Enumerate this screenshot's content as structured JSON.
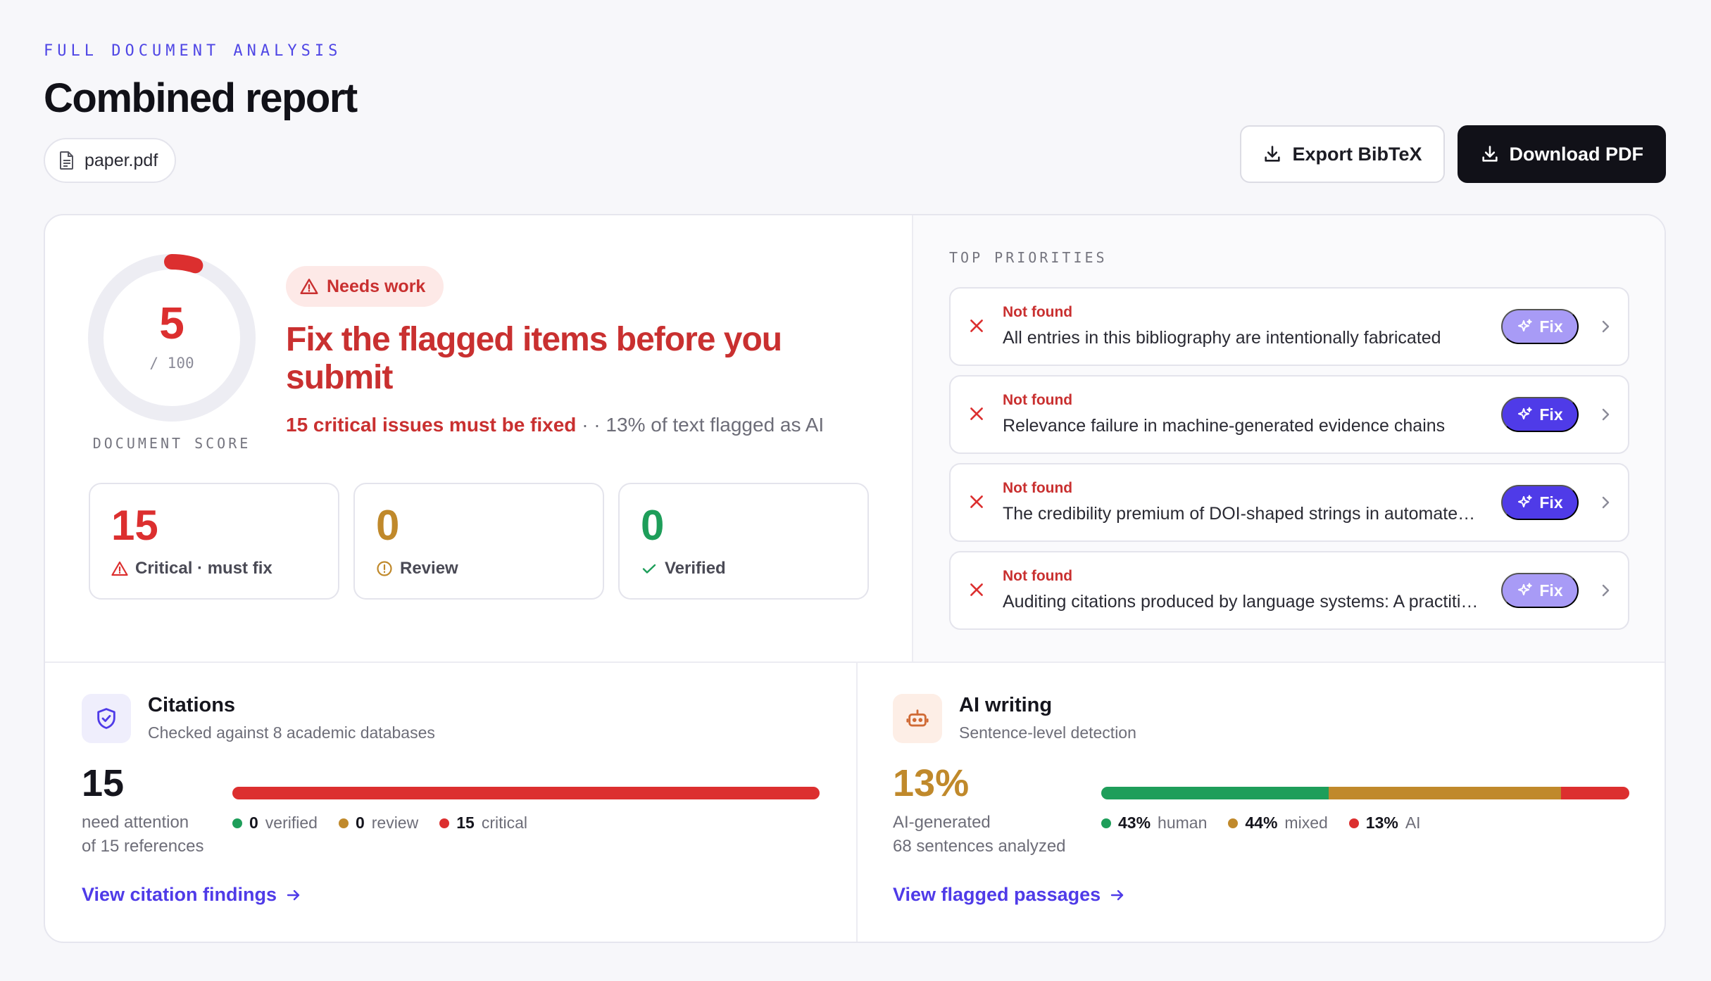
{
  "header": {
    "eyebrow": "FULL DOCUMENT ANALYSIS",
    "title": "Combined report",
    "file_name": "paper.pdf",
    "export_label": "Export BibTeX",
    "download_label": "Download PDF"
  },
  "score": {
    "value": "5",
    "denominator": "/ 100",
    "caption": "DOCUMENT SCORE",
    "fraction": 0.05,
    "status_label": "Needs work",
    "headline": "Fix the flagged items before you submit",
    "critical_summary": "15 critical issues must be fixed",
    "separator": "· ·",
    "ai_summary": "13% of text flagged as AI"
  },
  "stats": [
    {
      "value": "15",
      "label": "Critical · must fix",
      "color": "#dc2f2f"
    },
    {
      "value": "0",
      "label": "Review",
      "color": "#c0892b"
    },
    {
      "value": "0",
      "label": "Verified",
      "color": "#1e9e5a"
    }
  ],
  "priorities": {
    "heading": "TOP PRIORITIES",
    "fix_label": "Fix",
    "items": [
      {
        "status": "Not found",
        "text": "All entries in this bibliography are intentionally fabricated",
        "fix_active": false
      },
      {
        "status": "Not found",
        "text": "Relevance failure in machine-generated evidence chains",
        "fix_active": true
      },
      {
        "status": "Not found",
        "text": "The credibility premium of DOI-shaped strings in automated reference lists",
        "fix_active": true
      },
      {
        "status": "Not found",
        "text": "Auditing citations produced by language systems: A practitioner's guide",
        "fix_active": false
      }
    ]
  },
  "citations": {
    "title": "Citations",
    "subtitle": "Checked against 8 academic databases",
    "count": "15",
    "count_label_1": "need attention",
    "count_label_2": "of 15 references",
    "verified_count": "0",
    "verified_label": "verified",
    "review_count": "0",
    "review_label": "review",
    "critical_count": "15",
    "critical_label": "critical",
    "shares": {
      "verified": 0,
      "review": 0,
      "critical": 1
    },
    "link": "View citation findings"
  },
  "ai": {
    "title": "AI writing",
    "subtitle": "Sentence-level detection",
    "percent": "13%",
    "label_1": "AI-generated",
    "label_2": "68 sentences analyzed",
    "human_pct": "43%",
    "human_label": "human",
    "mixed_pct": "44%",
    "mixed_label": "mixed",
    "ai_pct": "13%",
    "ai_label": "AI",
    "shares": {
      "human": 0.43,
      "mixed": 0.44,
      "ai": 0.13
    },
    "link": "View flagged passages"
  },
  "colors": {
    "accent": "#4f3be8",
    "critical": "#dc2f2f",
    "review": "#c0892b",
    "verified": "#1e9e5a"
  }
}
